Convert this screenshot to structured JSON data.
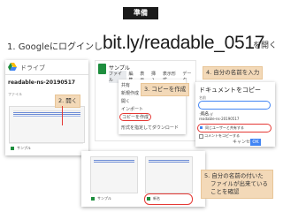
{
  "header": {
    "badge": "準備",
    "step1_prefix": "1. Googleにログインし",
    "url": "bit.ly/readable_0517",
    "step1_suffix": "を開く"
  },
  "callouts": {
    "open": "2. 開く",
    "copy": "3. コピーを作成",
    "name": "4. 自分の名前を入力",
    "confirm_line1": "5. 自分の名前の付いた",
    "confirm_line2": "ファイルが出来ている",
    "confirm_line3": "ことを確認"
  },
  "drive": {
    "app_name": "ドライブ",
    "folder": "readable-ns-20190517",
    "section": "ファイル",
    "file_name": "サンプル"
  },
  "sheets": {
    "title": "サンプル",
    "menus": [
      "ファイル",
      "編集",
      "表示",
      "挿入",
      "表示形式",
      "データ"
    ],
    "menu_items": [
      "共有",
      "新規作成",
      "開く",
      "インポート",
      "コピーを作成",
      "形式を指定してダウンロード"
    ]
  },
  "dialog": {
    "title": "ドキュメントをコピー",
    "name_label": "名前",
    "name_value": "新名",
    "folder_label": "フォルダ",
    "folder_value": "readable-ns-20190517",
    "opt1": "同じユーザーと共有する",
    "opt2": "コメントをコピーする",
    "ok": "OK",
    "cancel": "キャンセル"
  },
  "result": {
    "file1": "サンプル",
    "file2": "新名"
  },
  "colors": {
    "accent_red": "#e53935",
    "callout_bg": "#f3d9b8",
    "sheets_green": "#1e8e3e",
    "link_blue": "#4285f4"
  }
}
